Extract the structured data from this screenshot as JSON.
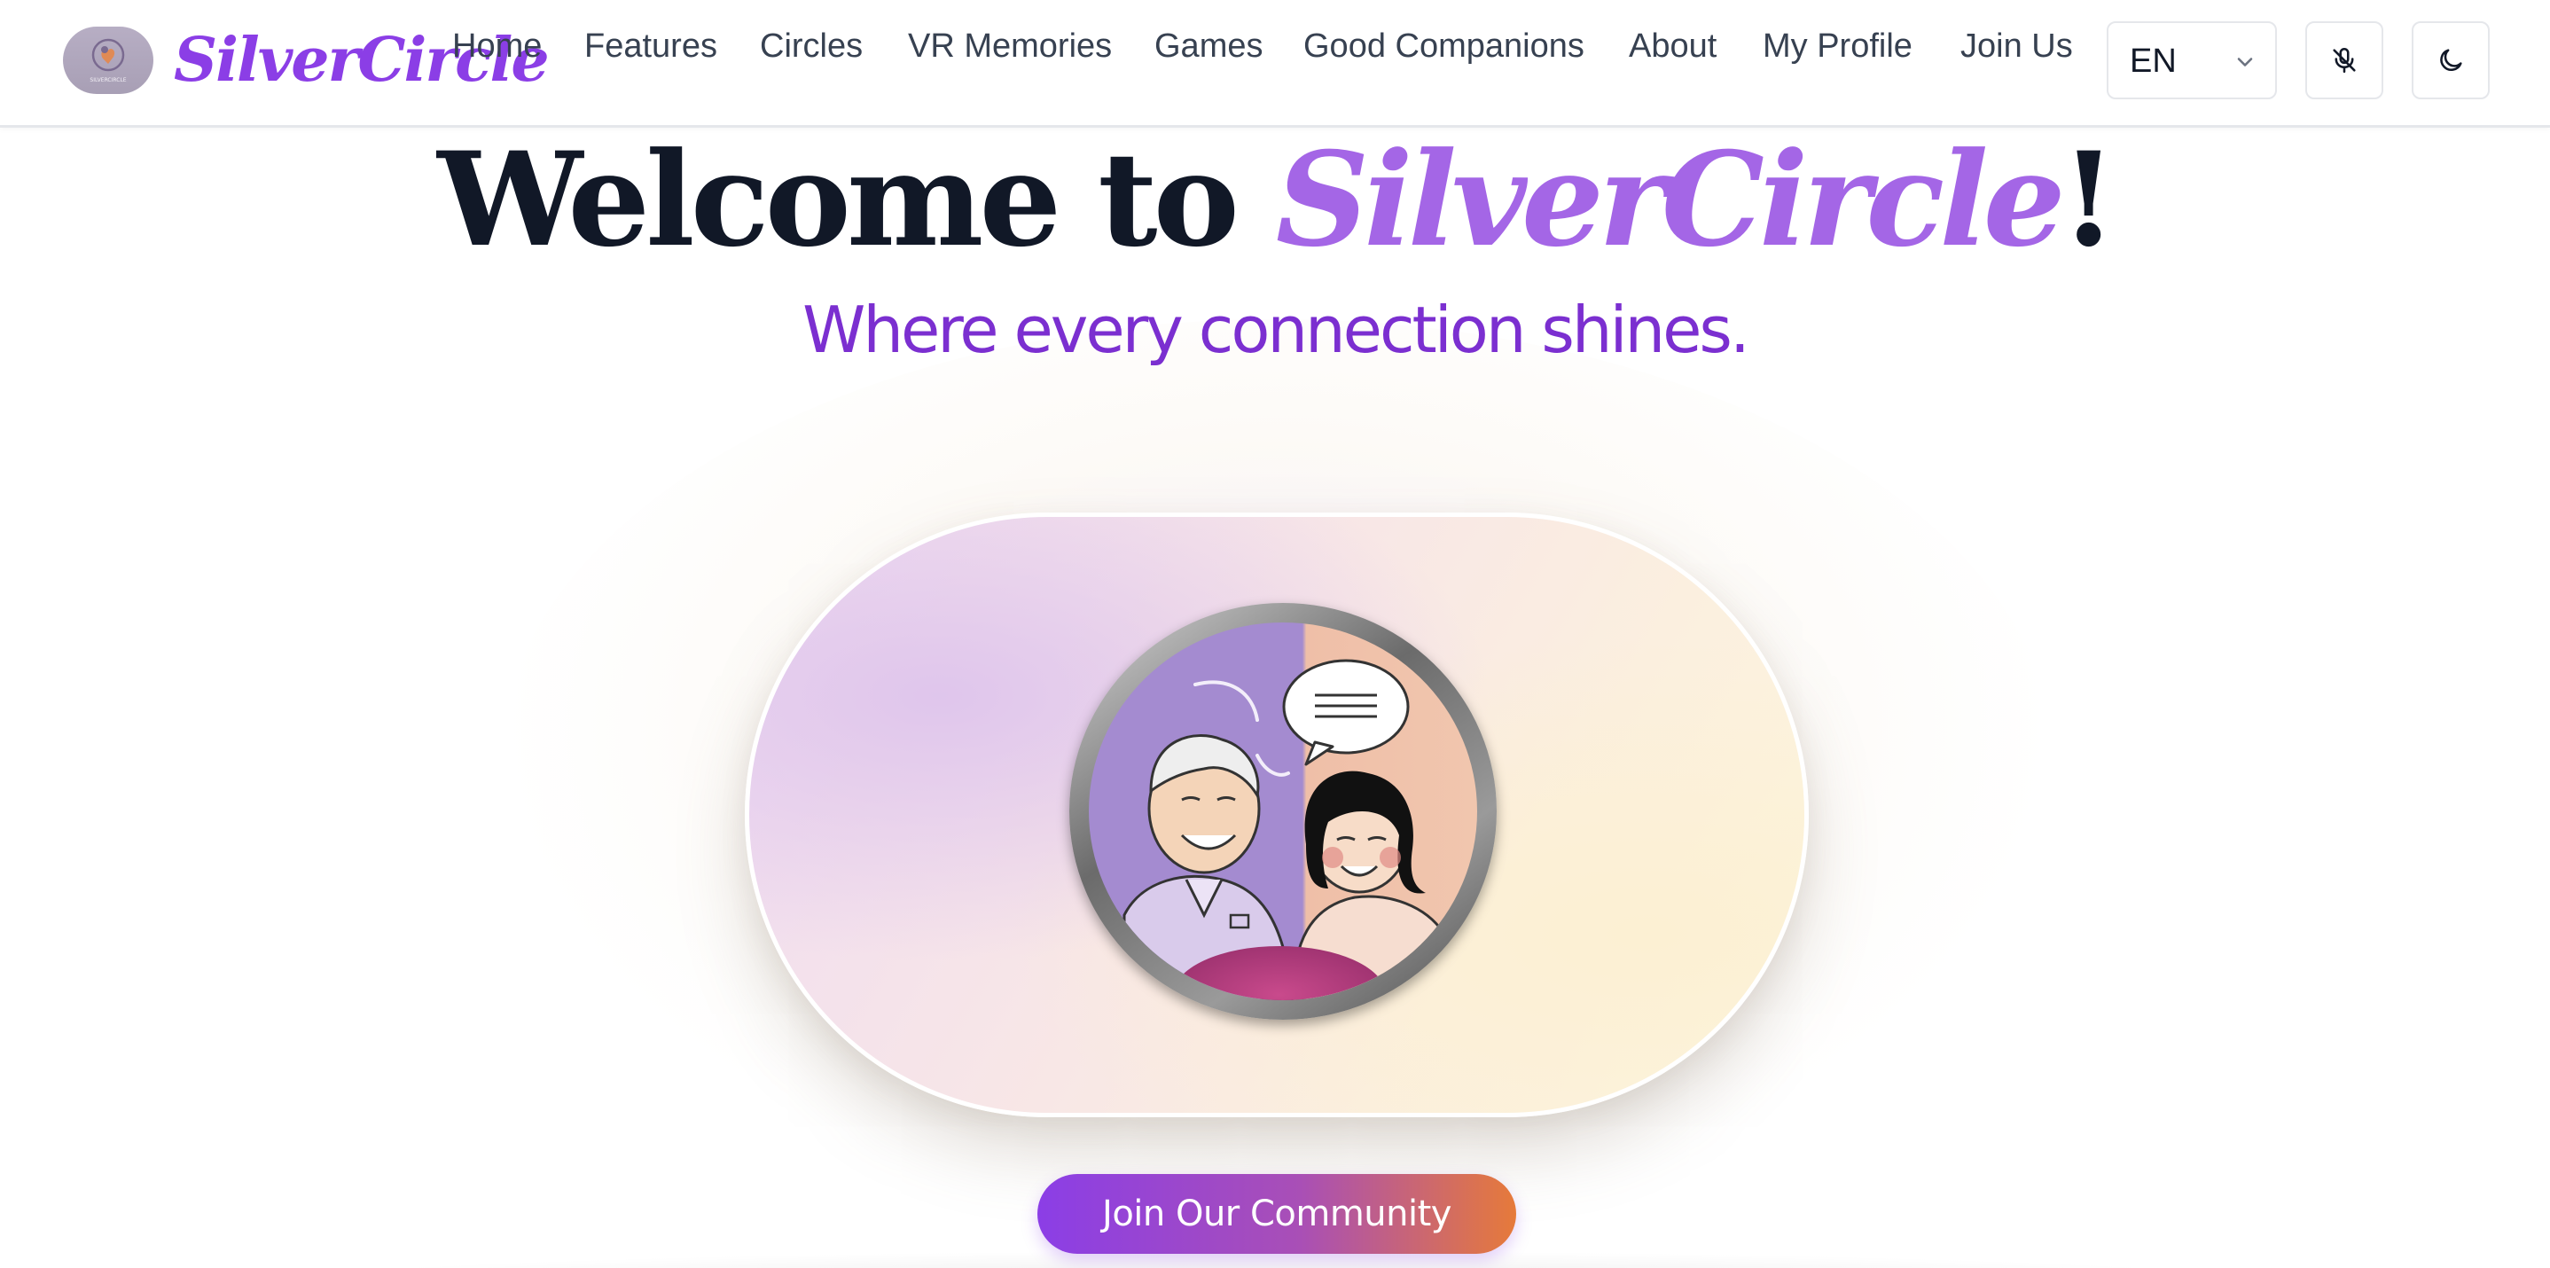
{
  "brand": {
    "name": "SilverCircle",
    "logo_badge_text": "SILVERCIRCLE",
    "colors": {
      "primary": "#8b3ee6",
      "accent_orange": "#e67a3a",
      "brand_light": "#a466e6"
    }
  },
  "nav": {
    "links": [
      {
        "label": "Home"
      },
      {
        "label": "Features"
      },
      {
        "label": "Circles"
      },
      {
        "label": "VR Memories"
      },
      {
        "label": "Games"
      },
      {
        "label": "Good Companions"
      },
      {
        "label": "About"
      },
      {
        "label": "My Profile"
      },
      {
        "label": "Join Us"
      }
    ],
    "language": {
      "selected": "EN",
      "icon": "chevron-down-icon"
    },
    "buttons": [
      {
        "icon": "mic-off-icon"
      },
      {
        "icon": "moon-icon"
      }
    ]
  },
  "hero": {
    "title_prefix": "Welcome to ",
    "title_brand": "SilverCircle",
    "title_suffix": "!",
    "tagline": "Where every connection shines.",
    "image_subject": "elderly-man-and-young-woman-chatting-illustration",
    "cta_label": "Join Our Community"
  }
}
